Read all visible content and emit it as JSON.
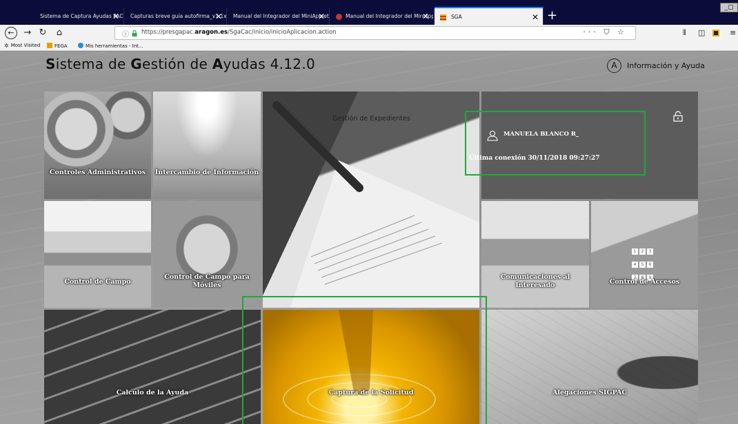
{
  "browser": {
    "tabs": [
      {
        "title": "Sistema de Captura Ayudas PAC (SGA"
      },
      {
        "title": "Capturas breve guía autofirma_v1.1x"
      },
      {
        "title": "Manual del Integrador del MiniApplet d"
      },
      {
        "title": "Manual del Integrador del MiniApp"
      },
      {
        "title": "SGA"
      }
    ],
    "new_tab": "+",
    "window_controls": "_▢",
    "url_prefix": "https://presgapac.",
    "url_domain": "aragon.es",
    "url_path": "/SgaCac/inicio/inicioAplicacion.action",
    "url_tools": "··· ⛉ ☆",
    "bookmarks": [
      {
        "label": "Most Visited"
      },
      {
        "label": "FEGA"
      },
      {
        "label": "Mis herramientas - Int..."
      }
    ]
  },
  "app": {
    "title_parts": [
      {
        "bold": "S",
        "rest": "istema de "
      },
      {
        "bold": "G",
        "rest": "estión de "
      },
      {
        "bold": "A",
        "rest": "yudas 4.12.0"
      }
    ],
    "help_circle": "A",
    "help_label": "Información y Ayuda"
  },
  "user": {
    "name": "MANUELA BLANCO R_",
    "last_connection": "Última conexión  30/11/2018 09:27:27"
  },
  "tiles": {
    "controles": "Controles Administrativos",
    "intercambio": "Intercambio de Información",
    "gestion": "Gestión de Expedientes",
    "control_campo": "Control de Campo",
    "control_moviles_1": "Control de Campo para",
    "control_moviles_2": "Móviles",
    "comunicaciones_1": "Comunicaciones al",
    "comunicaciones_2": "Interesado",
    "accesos": "Control de Accesos",
    "calculo": "Calculo de la Ayuda",
    "captura": "Captura de la Solicitud",
    "alegaciones": "Alegaciones SIGPAC"
  },
  "colors": {
    "highlight": "#1fa83a",
    "active_tab_border": "#0a84ff",
    "user_panel": "#5c5c5c"
  }
}
